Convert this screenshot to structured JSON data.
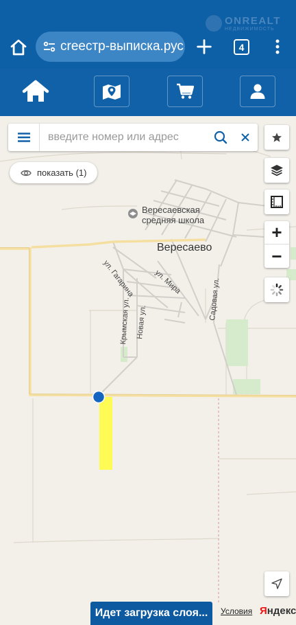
{
  "browser": {
    "url": "сreестр-выписка.рус",
    "tab_count": "4",
    "watermark": {
      "brand": "ONREALT",
      "sub": "НЕДВИЖИМОСТЬ"
    }
  },
  "app_nav": {
    "items": [
      {
        "icon": "home-icon"
      },
      {
        "icon": "map-marker-icon"
      },
      {
        "icon": "cart-icon"
      },
      {
        "icon": "user-icon"
      }
    ]
  },
  "search": {
    "placeholder": "введите номер или адрес",
    "value": ""
  },
  "show_button": {
    "label": "показать (1)"
  },
  "map": {
    "labels": {
      "school": "Вересаевская",
      "school2": "средняя школа",
      "village": "Вересаево",
      "gagarina": "ул. Гагарина",
      "mira": "ул. Мира",
      "krymskaya": "Крымская ул.",
      "novaya": "Новая ул.",
      "sadovaya": "Садовая ул."
    },
    "colors": {
      "parcel": "#fffb55",
      "marker": "#1565c0",
      "road": "#f5dfa0",
      "greenery": "#cfe9c4"
    }
  },
  "controls": {
    "zoom_in": "+",
    "zoom_out": "−"
  },
  "footer": {
    "loading": "Идет загрузка слоя...",
    "terms": "Условия",
    "yandex_y": "Я",
    "yandex_rest": "ндекс"
  }
}
